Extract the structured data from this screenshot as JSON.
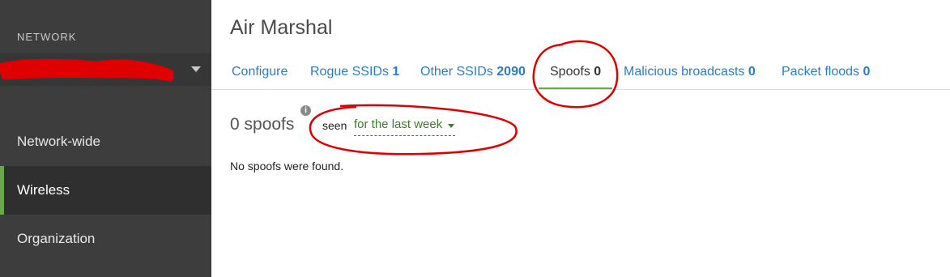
{
  "sidebar": {
    "section_label": "NETWORK",
    "network_name": "",
    "items": [
      {
        "label": "Network-wide"
      },
      {
        "label": "Wireless"
      },
      {
        "label": "Organization"
      }
    ]
  },
  "page": {
    "title": "Air Marshal"
  },
  "tabs": [
    {
      "label": "Configure",
      "count": ""
    },
    {
      "label": "Rogue SSIDs",
      "count": "1"
    },
    {
      "label": "Other SSIDs",
      "count": "2090"
    },
    {
      "label": "Spoofs",
      "count": "0"
    },
    {
      "label": "Malicious broadcasts",
      "count": "0"
    },
    {
      "label": "Packet floods",
      "count": "0"
    }
  ],
  "content": {
    "count_text": "0 spoofs",
    "info_icon": "i",
    "seen_label": "seen",
    "time_filter": "for the last week",
    "empty_message": "No spoofs were found."
  },
  "colors": {
    "sidebar_bg": "#3d3d3d",
    "accent_green": "#6aa84f",
    "link_blue": "#2d7bc4",
    "annotation_red": "#e00000"
  }
}
